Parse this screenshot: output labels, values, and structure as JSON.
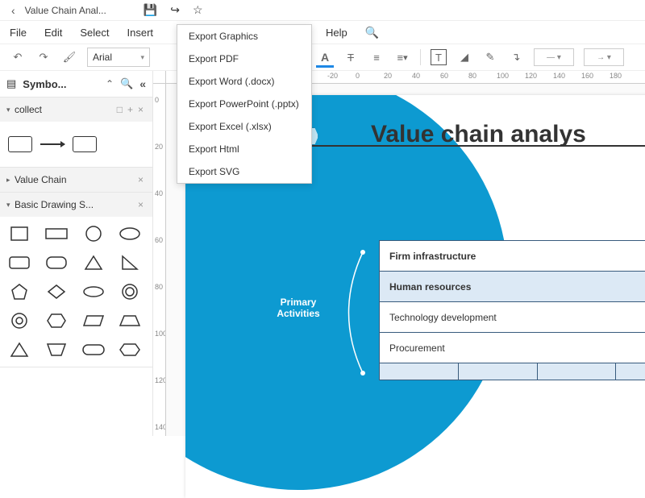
{
  "titlebar": {
    "title": "Value Chain Anal..."
  },
  "menu": {
    "file": "File",
    "edit": "Edit",
    "select": "Select",
    "insert": "Insert",
    "help": "Help"
  },
  "toolbar": {
    "font": "Arial"
  },
  "export": {
    "items": [
      "Export Graphics",
      "Export PDF",
      "Export Word (.docx)",
      "Export PowerPoint (.pptx)",
      "Export Excel (.xlsx)",
      "Export Html",
      "Export SVG"
    ]
  },
  "sidebar": {
    "title": "Symbo...",
    "sections": {
      "collect": {
        "label": "collect"
      },
      "valuechain": {
        "label": "Value Chain"
      },
      "basic": {
        "label": "Basic Drawing S..."
      }
    }
  },
  "hruler": [
    -20,
    0,
    20,
    40,
    60,
    80,
    100,
    120,
    140,
    160,
    180
  ],
  "vruler": [
    0,
    20,
    40,
    60,
    80,
    100,
    120,
    140
  ],
  "diagram": {
    "title": "Value chain analys",
    "primary": "Primary\nActivities",
    "rows": [
      "Firm infrastructure",
      "Human resources",
      "Technology development",
      "Procurement"
    ]
  }
}
